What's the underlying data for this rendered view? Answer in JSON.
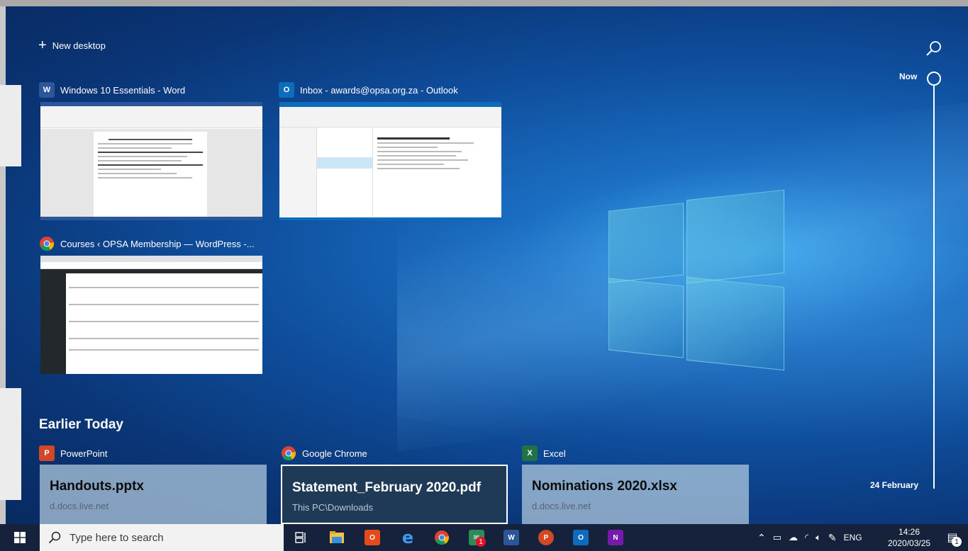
{
  "timeline": {
    "new_desktop_label": "New desktop",
    "now_label": "Now",
    "feb_label": "24 February"
  },
  "windows": [
    {
      "app": "Word",
      "icon": "word-icon",
      "title": "Windows 10 Essentials - Word",
      "color": "#2b579a"
    },
    {
      "app": "Outlook",
      "icon": "outlook-icon",
      "title": "Inbox - awards@opsa.org.za - Outlook",
      "color": "#0f6cbd"
    },
    {
      "app": "Chrome",
      "icon": "chrome-icon",
      "title": "Courses ‹ OPSA Membership — WordPress -..."
    }
  ],
  "earlier": {
    "section_title": "Earlier Today",
    "cards": [
      {
        "app": "PowerPoint",
        "icon": "powerpoint-icon",
        "file": "Handouts.pptx",
        "path": "d.docs.live.net",
        "color": "#d24726"
      },
      {
        "app": "Google Chrome",
        "icon": "chrome-icon",
        "file": "Statement_February 2020.pdf",
        "path": "This PC\\Downloads",
        "selected": true
      },
      {
        "app": "Excel",
        "icon": "excel-icon",
        "file": "Nominations 2020.xlsx",
        "path": "d.docs.live.net",
        "color": "#217346"
      }
    ]
  },
  "taskbar": {
    "search_placeholder": "Type here to search",
    "tray_lang": "ENG",
    "time": "14:26",
    "date": "2020/03/25",
    "notification_badge": "1",
    "mail_badge": "1"
  },
  "colors": {
    "accent": "#0078d7",
    "taskbar": "#16213b"
  }
}
